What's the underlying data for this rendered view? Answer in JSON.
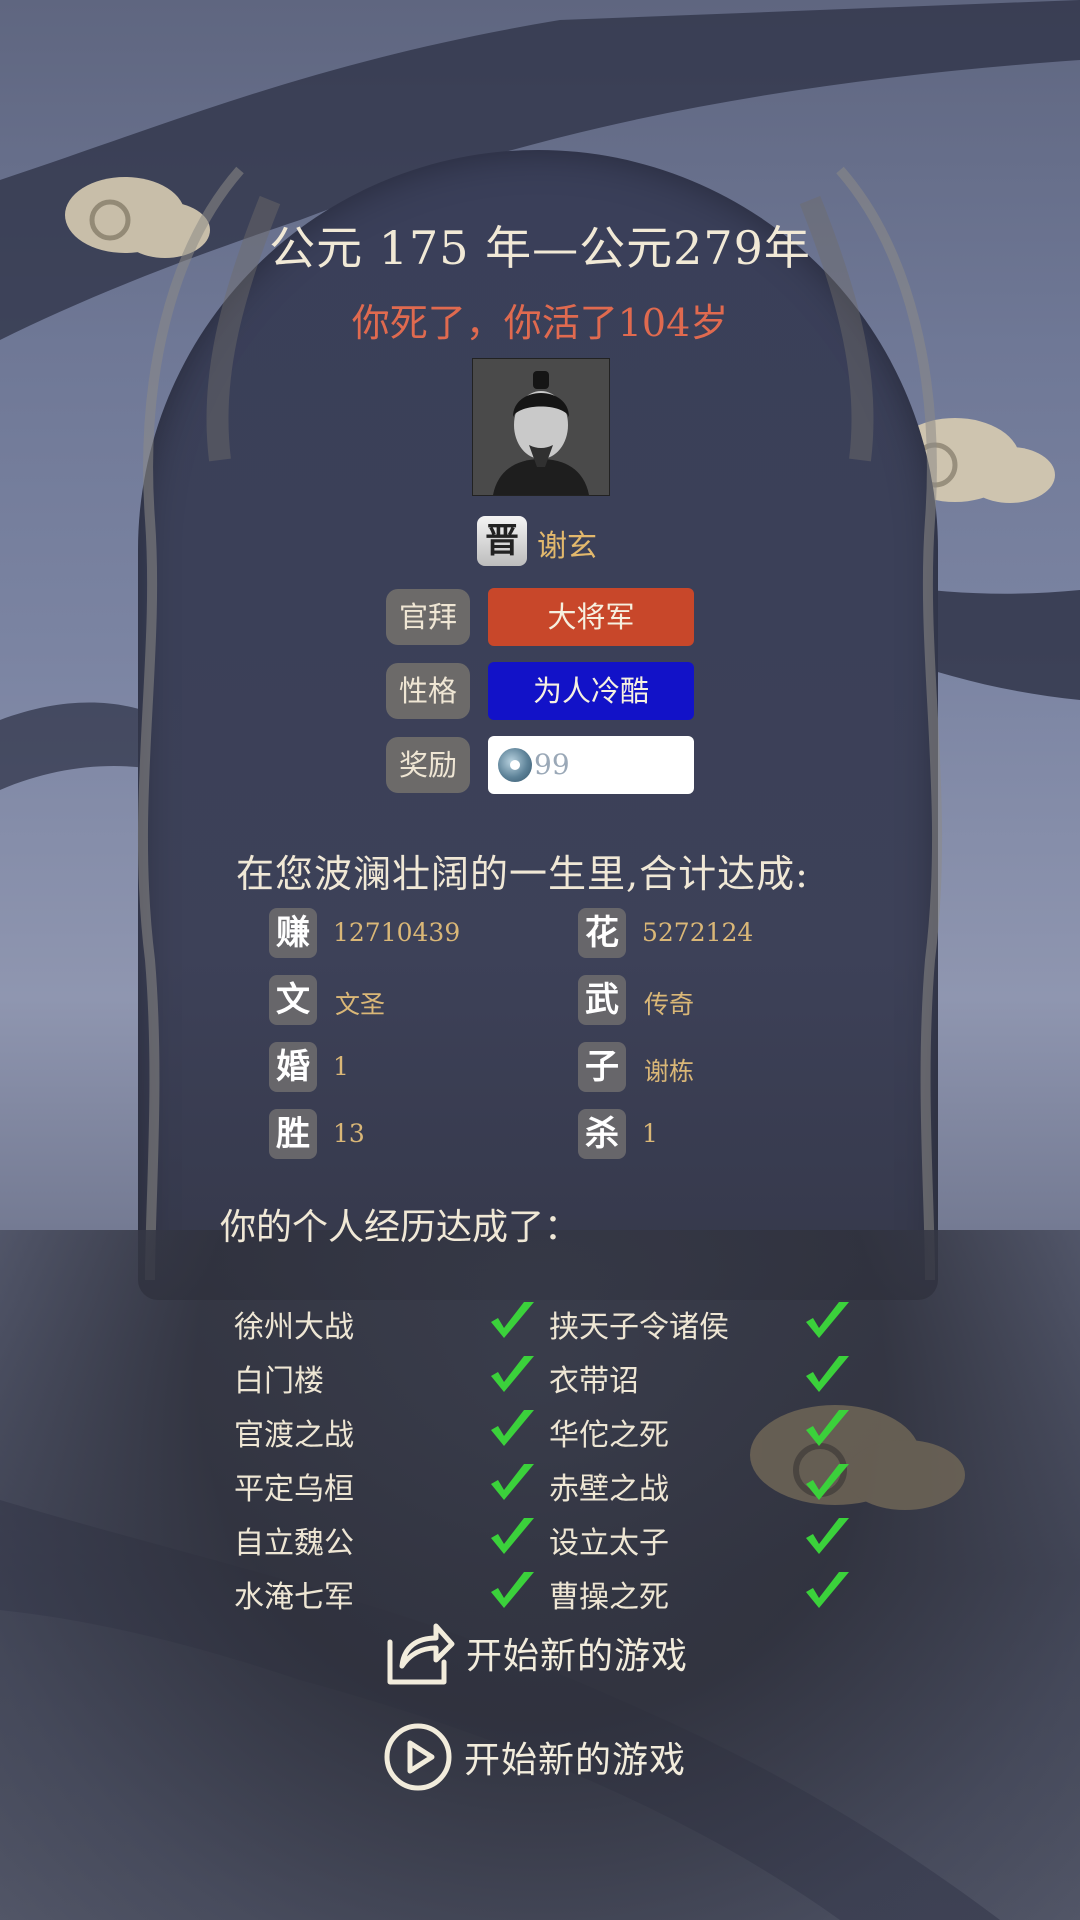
{
  "header": {
    "years": "公元 175 年—公元279年",
    "death_message": "你死了，你活了104岁"
  },
  "character": {
    "nation": "晋",
    "name": "谢玄"
  },
  "info": {
    "official_label": "官拜",
    "official_value": "大将军",
    "personality_label": "性格",
    "personality_value": "为人冷酷",
    "reward_label": "奖励",
    "reward_value": "99"
  },
  "summary_title": "在您波澜壮阔的一生里,合计达成:",
  "stats": [
    {
      "badge": "赚",
      "value": "12710439"
    },
    {
      "badge": "花",
      "value": "5272124"
    },
    {
      "badge": "文",
      "value": "文圣"
    },
    {
      "badge": "武",
      "value": "传奇"
    },
    {
      "badge": "婚",
      "value": "1"
    },
    {
      "badge": "子",
      "value": "谢栋"
    },
    {
      "badge": "胜",
      "value": "13"
    },
    {
      "badge": "杀",
      "value": "1"
    }
  ],
  "experience_title": "你的个人经历达成了：",
  "experiences": [
    {
      "name": "徐州大战",
      "done": true
    },
    {
      "name": "挟天子令诸侯",
      "done": true
    },
    {
      "name": "白门楼",
      "done": true
    },
    {
      "name": "衣带诏",
      "done": true
    },
    {
      "name": "官渡之战",
      "done": true
    },
    {
      "name": "华佗之死",
      "done": true
    },
    {
      "name": "平定乌桓",
      "done": true
    },
    {
      "name": "赤壁之战",
      "done": true
    },
    {
      "name": "自立魏公",
      "done": true
    },
    {
      "name": "设立太子",
      "done": true
    },
    {
      "name": "水淹七军",
      "done": true
    },
    {
      "name": "曹操之死",
      "done": true
    }
  ],
  "buttons": {
    "share_label": "开始新的游戏",
    "new_game_label": "开始新的游戏"
  },
  "colors": {
    "official": "#c8472a",
    "personality": "#1212c8",
    "death_text": "#e06a4f",
    "stat_value": "#dab777",
    "check": "#3bd13b"
  }
}
